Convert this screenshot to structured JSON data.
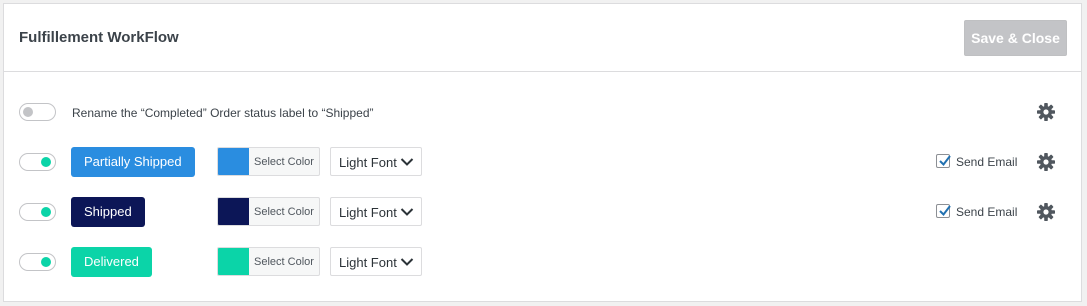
{
  "header": {
    "title": "Fulfillement WorkFlow",
    "save_label": "Save & Close"
  },
  "rename_row": {
    "toggle_on": false,
    "text": "Rename the “Completed” Order status label to “Shipped”"
  },
  "statuses": [
    {
      "label": "Partially Shipped",
      "color": "#2a8de0",
      "select_color": "Select Color",
      "font": "Light Font",
      "send_email_label": "Send Email",
      "send_email_checked": true,
      "toggle_on": true
    },
    {
      "label": "Shipped",
      "color": "#0c1657",
      "select_color": "Select Color",
      "font": "Light Font",
      "send_email_label": "Send Email",
      "send_email_checked": true,
      "toggle_on": true
    },
    {
      "label": "Delivered",
      "color": "#0bd4a8",
      "select_color": "Select Color",
      "font": "Light Font",
      "toggle_on": true
    }
  ],
  "icons": {
    "settings": "gear-icon",
    "dropdown": "chevron-down-icon",
    "check": "checkmark-icon"
  },
  "colors": {
    "toggle_on": "#0bd4a8",
    "button_disabled": "#c3c4c7",
    "gear": "#50575e"
  }
}
